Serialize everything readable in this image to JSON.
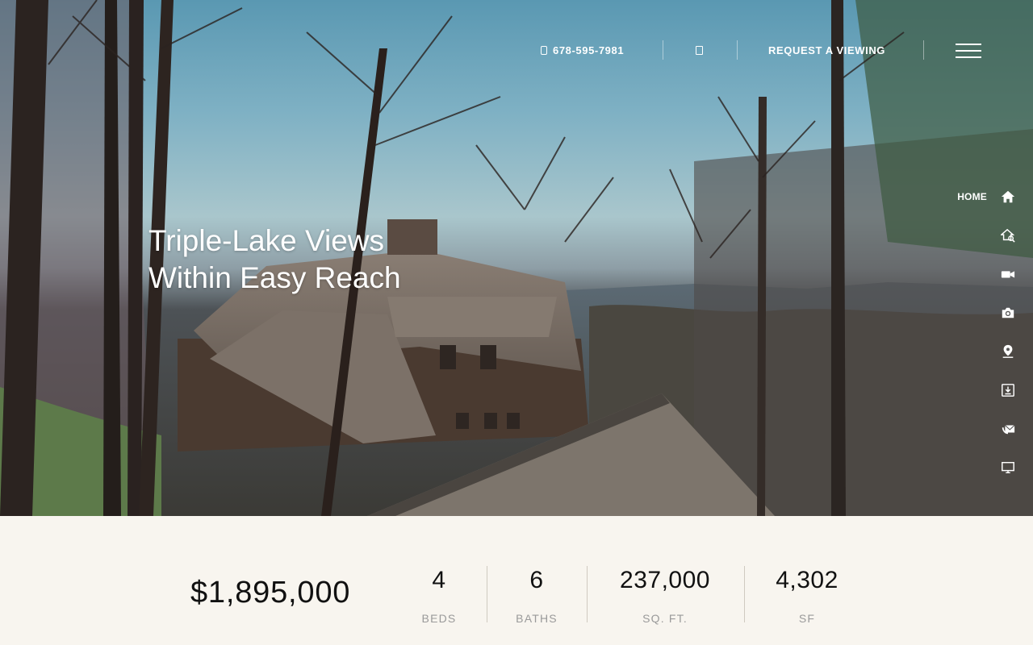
{
  "topbar": {
    "phone": "678-595-7981",
    "request_label": "REQUEST A VIEWING"
  },
  "hero": {
    "headline_line1": "Triple-Lake Views",
    "headline_line2": "Within Easy Reach"
  },
  "sidenav": {
    "items": [
      {
        "label": "HOME",
        "icon": "home-icon"
      },
      {
        "label": "",
        "icon": "property-search-icon"
      },
      {
        "label": "",
        "icon": "video-icon"
      },
      {
        "label": "",
        "icon": "camera-icon"
      },
      {
        "label": "",
        "icon": "map-marker-icon"
      },
      {
        "label": "",
        "icon": "download-icon"
      },
      {
        "label": "",
        "icon": "contact-icon"
      },
      {
        "label": "",
        "icon": "monitor-icon"
      }
    ]
  },
  "stats": {
    "price": "$1,895,000",
    "beds": {
      "value": "4",
      "label": "BEDS"
    },
    "baths": {
      "value": "6",
      "label": "BATHS"
    },
    "sqft": {
      "value": "237,000",
      "label": "SQ. FT."
    },
    "sf": {
      "value": "4,302",
      "label": "SF"
    }
  },
  "colors": {
    "stats_background": "#f8f5ef",
    "label_gray": "#9a9a9a"
  }
}
